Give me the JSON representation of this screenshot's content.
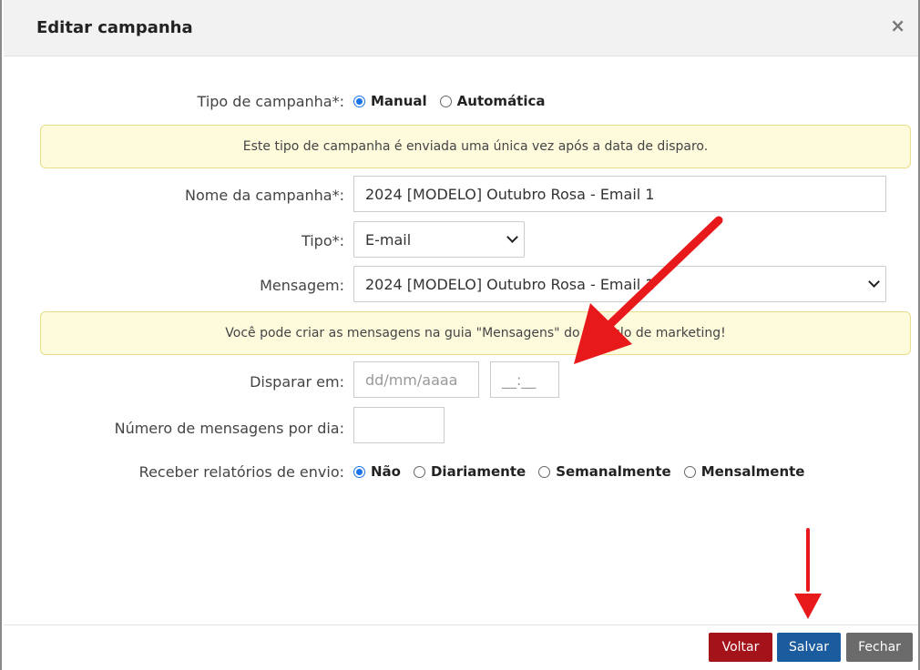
{
  "modal": {
    "title": "Editar campanha",
    "close_label": "×"
  },
  "form": {
    "campaign_type": {
      "label": "Tipo de campanha*:",
      "options": [
        {
          "label": "Manual",
          "selected": true
        },
        {
          "label": "Automática",
          "selected": false
        }
      ]
    },
    "info_alert": "Este tipo de campanha é enviada uma única vez após a data de disparo.",
    "campaign_name": {
      "label": "Nome da campanha*:",
      "value": "2024 [MODELO] Outubro Rosa - Email 1"
    },
    "type": {
      "label": "Tipo*:",
      "value": "E-mail"
    },
    "message": {
      "label": "Mensagem:",
      "value": "2024 [MODELO] Outubro Rosa - Email 1"
    },
    "messages_alert": "Você pode criar as mensagens na guia \"Mensagens\" do módulo de marketing!",
    "send_at": {
      "label": "Disparar em:",
      "date_placeholder": "dd/mm/aaaa",
      "time_placeholder": "__:__"
    },
    "messages_per_day": {
      "label": "Número de mensagens por dia:",
      "value": ""
    },
    "reports": {
      "label": "Receber relatórios de envio:",
      "options": [
        {
          "label": "Não",
          "selected": true
        },
        {
          "label": "Diariamente",
          "selected": false
        },
        {
          "label": "Semanalmente",
          "selected": false
        },
        {
          "label": "Mensalmente",
          "selected": false
        }
      ]
    }
  },
  "footer": {
    "voltar": "Voltar",
    "salvar": "Salvar",
    "fechar": "Fechar"
  },
  "colors": {
    "accent": "#1a73e8",
    "voltar": "#a4121a",
    "salvar": "#1b5c9e",
    "fechar": "#6b6b6b",
    "alert_bg": "#fdfbdc",
    "arrow": "#e8191b"
  }
}
